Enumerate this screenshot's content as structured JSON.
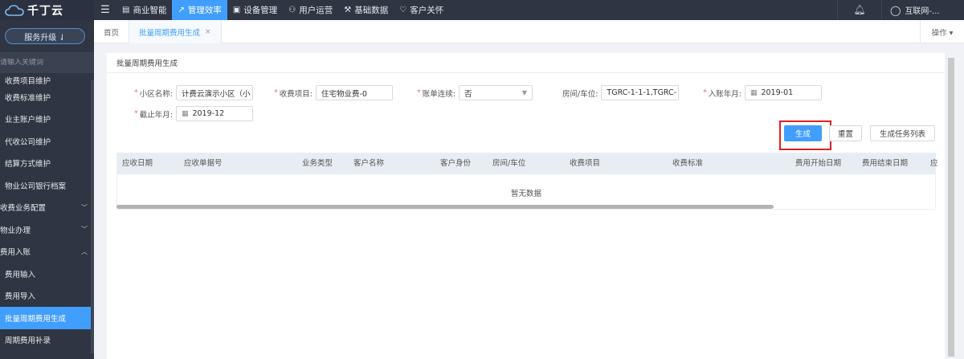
{
  "brand": {
    "name": "千丁云",
    "upgrade_label": "服务升级 ⇃"
  },
  "sidebar": {
    "search_placeholder": "请输入关键词",
    "items": [
      {
        "label": "收费项目维护",
        "type": "cut"
      },
      {
        "label": "收费标准维护"
      },
      {
        "label": "业主账户维护"
      },
      {
        "label": "代收公司维护"
      },
      {
        "label": "结算方式维护"
      },
      {
        "label": "物业公司银行档案"
      },
      {
        "label": "收费业务配置",
        "expand": "﹀"
      },
      {
        "label": "物业办理",
        "expand": "﹀"
      },
      {
        "label": "费用入账",
        "expand": "︿"
      },
      {
        "label": "费用输入"
      },
      {
        "label": "费用导入"
      },
      {
        "label": "批量周期费用生成",
        "active": true
      },
      {
        "label": "周期费用补录"
      }
    ]
  },
  "topnav": {
    "items": [
      {
        "label": "商业智能",
        "icon": "building-icon"
      },
      {
        "label": "管理效率",
        "icon": "chart-icon",
        "active": true
      },
      {
        "label": "设备管理",
        "icon": "device-icon"
      },
      {
        "label": "用户运营",
        "icon": "user-ops-icon"
      },
      {
        "label": "基础数据",
        "icon": "wrench-icon"
      },
      {
        "label": "客户关怀",
        "icon": "heart-icon"
      }
    ],
    "user_name": "互联网-..."
  },
  "tabs": {
    "home": "首页",
    "current": "批量周期费用生成",
    "ops": "操作 ▾"
  },
  "page": {
    "title": "批量周期费用生成",
    "form": {
      "community": {
        "label": "小区名称:",
        "value": "计费云演示小区（小"
      },
      "fee_item": {
        "label": "收费项目:",
        "value": "住宅物业费-0"
      },
      "continuous": {
        "label": "账单连续:",
        "value": "否"
      },
      "room": {
        "label": "房间/车位:",
        "value": "TGRC-1-1-1,TGRC-"
      },
      "start_month": {
        "label": "入账年月:",
        "value": "2019-01"
      },
      "end_month": {
        "label": "截止年月:",
        "value": "2019-12"
      }
    },
    "buttons": {
      "generate": "生成",
      "reset": "重置",
      "task_list": "生成任务列表"
    },
    "table": {
      "columns": [
        "应收日期",
        "应收单据号",
        "业务类型",
        "客户名称",
        "客户身份",
        "房间/车位",
        "收费项目",
        "收费标准",
        "费用开始日期",
        "费用结束日期",
        "应"
      ],
      "empty_text": "暂无数据"
    }
  }
}
